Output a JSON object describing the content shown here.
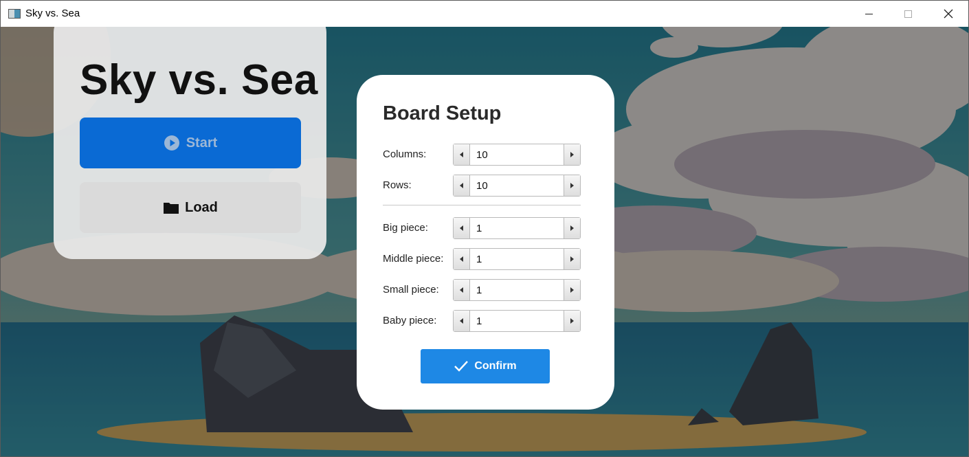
{
  "window": {
    "title": "Sky vs. Sea"
  },
  "menu": {
    "title": "Sky vs. Sea",
    "start_label": "Start",
    "load_label": "Load"
  },
  "dialog": {
    "title": "Board Setup",
    "fields": [
      {
        "label": "Columns:",
        "value": "10"
      },
      {
        "label": "Rows:",
        "value": "10"
      },
      {
        "label": "Big piece:",
        "value": "1"
      },
      {
        "label": "Middle piece:",
        "value": "1"
      },
      {
        "label": "Small piece:",
        "value": "1"
      },
      {
        "label": "Baby piece:",
        "value": "1"
      }
    ],
    "confirm_label": "Confirm"
  },
  "colors": {
    "accent": "#1e88e5",
    "start_button": "#0a6ad4"
  }
}
